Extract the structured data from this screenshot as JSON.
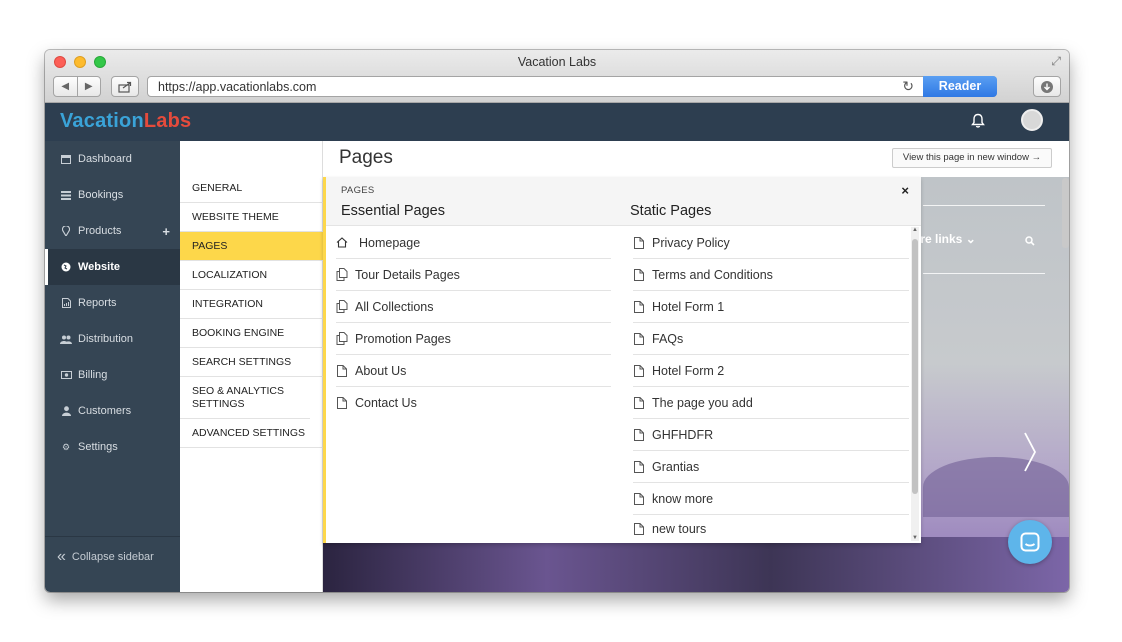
{
  "browser": {
    "window_title": "Vacation Labs",
    "url": "https://app.vacationlabs.com",
    "reader_label": "Reader"
  },
  "app": {
    "logo": {
      "part1": "Vacation",
      "part2": "Labs"
    },
    "colors": {
      "topbar": "#2d3e50",
      "sidebar": "#354554",
      "accent": "#fdd74a",
      "logo_blue": "#3aa3d8",
      "logo_red": "#e54b3c"
    }
  },
  "sidebar": {
    "items": [
      {
        "label": "Dashboard",
        "icon": "calendar-icon"
      },
      {
        "label": "Bookings",
        "icon": "list-icon"
      },
      {
        "label": "Products",
        "icon": "map-pin-icon",
        "extra": "+"
      },
      {
        "label": "Website",
        "icon": "globe-icon",
        "active": true
      },
      {
        "label": "Reports",
        "icon": "report-icon"
      },
      {
        "label": "Distribution",
        "icon": "users-icon"
      },
      {
        "label": "Billing",
        "icon": "money-icon"
      },
      {
        "label": "Customers",
        "icon": "user-icon"
      },
      {
        "label": "Settings",
        "icon": "gear-icon"
      }
    ],
    "collapse_label": "Collapse sidebar"
  },
  "subnav": {
    "items": [
      {
        "label": "GENERAL"
      },
      {
        "label": "WEBSITE THEME"
      },
      {
        "label": "PAGES",
        "active": true
      },
      {
        "label": "LOCALIZATION"
      },
      {
        "label": "INTEGRATION"
      },
      {
        "label": "BOOKING ENGINE"
      },
      {
        "label": "SEARCH SETTINGS"
      },
      {
        "label": "SEO & ANALYTICS SETTINGS"
      },
      {
        "label": "ADVANCED SETTINGS"
      }
    ]
  },
  "header": {
    "title": "Pages",
    "view_button": "View this page in new window →"
  },
  "panel": {
    "caption": "PAGES",
    "close": "×",
    "essential": {
      "title": "Essential Pages",
      "items": [
        {
          "label": "Homepage",
          "icon": "home-icon"
        },
        {
          "label": "Tour Details Pages",
          "icon": "copy-icon"
        },
        {
          "label": "All Collections",
          "icon": "copy-icon"
        },
        {
          "label": "Promotion Pages",
          "icon": "copy-icon"
        },
        {
          "label": "About Us",
          "icon": "file-icon"
        },
        {
          "label": "Contact Us",
          "icon": "file-icon"
        }
      ]
    },
    "static": {
      "title": "Static Pages",
      "items": [
        {
          "label": "Privacy Policy"
        },
        {
          "label": "Terms and Conditions"
        },
        {
          "label": "Hotel Form 1"
        },
        {
          "label": "FAQs"
        },
        {
          "label": "Hotel Form 2"
        },
        {
          "label": "The page you add"
        },
        {
          "label": "GHFHDFR"
        },
        {
          "label": "Grantias"
        },
        {
          "label": "know more"
        },
        {
          "label": "new tours"
        }
      ]
    }
  },
  "preview": {
    "more_links": "ore links ⌄"
  }
}
